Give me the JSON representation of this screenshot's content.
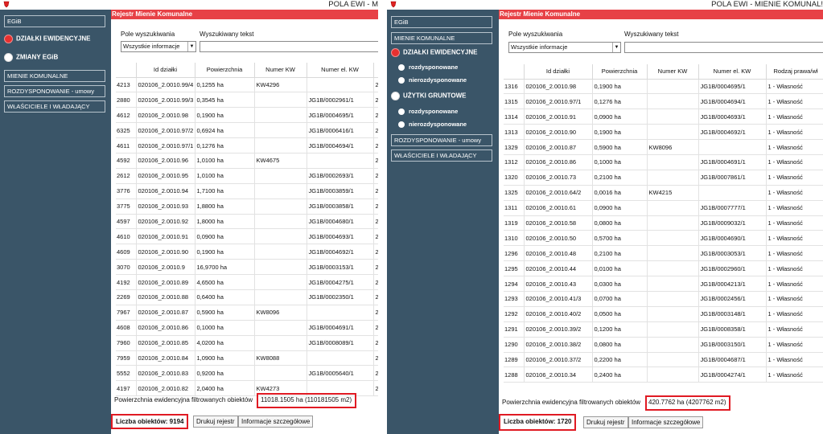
{
  "left": {
    "title": "POLA EWI - M",
    "sidebar": {
      "egib": "EGiB",
      "dzialki": "DZIAŁKI EWIDENCYJNE",
      "zmiany": "ZMIANY EGiB",
      "mienie": "MIENIE KOMUNALNE",
      "rozdysp": "ROZDYSPONOWANIE - umowy",
      "wlasciciele": "WŁAŚCICIELE I WŁADAJĄCY"
    },
    "header": "Rejestr Mienie Komunalne",
    "search": {
      "field_label": "Pole wyszukiwania",
      "field_value": "Wszystkie informacje",
      "text_label": "Wyszukiwany tekst",
      "text_value": ""
    },
    "columns": [
      "",
      "Id działki",
      "Powierzchnia",
      "Numer KW",
      "Numer el. KW",
      ""
    ],
    "rows": [
      [
        "4213",
        "020106_2.0010.99/4",
        "0,1255 ha",
        "KW4296",
        "",
        "2"
      ],
      [
        "2880",
        "020106_2.0010.99/3",
        "0,3545 ha",
        "",
        "JG1B/0002961/1",
        "2"
      ],
      [
        "4612",
        "020106_2.0010.98",
        "0,1900 ha",
        "",
        "JG1B/0004695/1",
        "2"
      ],
      [
        "6325",
        "020106_2.0010.97/2",
        "0,6924 ha",
        "",
        "JG1B/0006416/1",
        "2"
      ],
      [
        "4611",
        "020106_2.0010.97/1",
        "0,1276 ha",
        "",
        "JG1B/0004694/1",
        "2"
      ],
      [
        "4592",
        "020106_2.0010.96",
        "1,0100 ha",
        "KW4675",
        "",
        "2"
      ],
      [
        "2612",
        "020106_2.0010.95",
        "1,0100 ha",
        "",
        "JG1B/0002693/1",
        "2"
      ],
      [
        "3776",
        "020106_2.0010.94",
        "1,7100 ha",
        "",
        "JG1B/0003859/1",
        "2"
      ],
      [
        "3775",
        "020106_2.0010.93",
        "1,8800 ha",
        "",
        "JG1B/0003858/1",
        "2"
      ],
      [
        "4597",
        "020106_2.0010.92",
        "1,8000 ha",
        "",
        "JG1B/0004680/1",
        "2"
      ],
      [
        "4610",
        "020106_2.0010.91",
        "0,0900 ha",
        "",
        "JG1B/0004693/1",
        "2"
      ],
      [
        "4609",
        "020106_2.0010.90",
        "0,1900 ha",
        "",
        "JG1B/0004692/1",
        "2"
      ],
      [
        "3070",
        "020106_2.0010.9",
        "16,9700 ha",
        "",
        "JG1B/0003153/1",
        "2"
      ],
      [
        "4192",
        "020106_2.0010.89",
        "4,6500 ha",
        "",
        "JG1B/0004275/1",
        "2"
      ],
      [
        "2269",
        "020106_2.0010.88",
        "0,6400 ha",
        "",
        "JG1B/0002350/1",
        "2"
      ],
      [
        "7967",
        "020106_2.0010.87",
        "0,5900 ha",
        "KW8096",
        "",
        "2"
      ],
      [
        "4608",
        "020106_2.0010.86",
        "0,1000 ha",
        "",
        "JG1B/0004691/1",
        "2"
      ],
      [
        "7960",
        "020106_2.0010.85",
        "4,0200 ha",
        "",
        "JG1B/0008089/1",
        "2"
      ],
      [
        "7959",
        "020106_2.0010.84",
        "1,0900 ha",
        "KW8088",
        "",
        "2"
      ],
      [
        "5552",
        "020106_2.0010.83",
        "0,9200 ha",
        "",
        "JG1B/0005640/1",
        "2"
      ],
      [
        "4197",
        "020106_2.0010.82",
        "2,0400 ha",
        "KW4273",
        "",
        "2"
      ]
    ],
    "footer": {
      "area_label": "Powierzchnia ewidencyjna filtrowanych obiektów",
      "area_value": "11018.1505 ha (110181505 m2)",
      "count": "Liczba obiektów: 9194",
      "print": "Drukuj rejestr",
      "details": "Informacje szczegółowe"
    }
  },
  "right": {
    "title": "POLA EWI - MIENIE KOMUNAL!",
    "sidebar": {
      "egib": "EGiB",
      "mienie": "MIENIE KOMUNALNE",
      "dzialki": "DZIAŁKI EWIDENCYJNE",
      "rozdysp1": "rozdysponowane",
      "nierozdysp1": "nierozdysponowane",
      "uzytki": "UŻYTKI GRUNTOWE",
      "rozdysp2": "rozdysponowane",
      "nierozdysp2": "nierozdysponowane",
      "rozdysp_umowy": "ROZDYSPONOWANIE - umowy",
      "wlasciciele": "WŁAŚCICIELE I WŁADAJĄCY"
    },
    "header": "Rejestr Mienie Komunalne",
    "search": {
      "field_label": "Pole wyszukiwania",
      "field_value": "Wszystkie informacje",
      "text_label": "Wyszukiwany tekst",
      "text_value": ""
    },
    "columns": [
      "",
      "Id działki",
      "Powierzchnia",
      "Numer KW",
      "Numer el. KW",
      "Rodzaj prawa/wł"
    ],
    "rows": [
      [
        "1316",
        "020106_2.0010.98",
        "0,1900 ha",
        "",
        "JG1B/0004695/1",
        "1 - Własność"
      ],
      [
        "1315",
        "020106_2.0010.97/1",
        "0,1276 ha",
        "",
        "JG1B/0004694/1",
        "1 - Własność"
      ],
      [
        "1314",
        "020106_2.0010.91",
        "0,0900 ha",
        "",
        "JG1B/0004693/1",
        "1 - Własność"
      ],
      [
        "1313",
        "020106_2.0010.90",
        "0,1900 ha",
        "",
        "JG1B/0004692/1",
        "1 - Własność"
      ],
      [
        "1329",
        "020106_2.0010.87",
        "0,5900 ha",
        "KW8096",
        "",
        "1 - Własność"
      ],
      [
        "1312",
        "020106_2.0010.86",
        "0,1000 ha",
        "",
        "JG1B/0004691/1",
        "1 - Własność"
      ],
      [
        "1320",
        "020106_2.0010.73",
        "0,2100 ha",
        "",
        "JG1B/0007861/1",
        "1 - Własność"
      ],
      [
        "1325",
        "020106_2.0010.64/2",
        "0,0016 ha",
        "KW4215",
        "",
        "1 - Własność"
      ],
      [
        "1311",
        "020106_2.0010.61",
        "0,0900 ha",
        "",
        "JG1B/0007777/1",
        "1 - Własność"
      ],
      [
        "1319",
        "020106_2.0010.58",
        "0,0800 ha",
        "",
        "JG1B/0009032/1",
        "1 - Własność"
      ],
      [
        "1310",
        "020106_2.0010.50",
        "0,5700 ha",
        "",
        "JG1B/0004690/1",
        "1 - Własność"
      ],
      [
        "1296",
        "020106_2.0010.48",
        "0,2100 ha",
        "",
        "JG1B/0003053/1",
        "1 - Własność"
      ],
      [
        "1295",
        "020106_2.0010.44",
        "0,0100 ha",
        "",
        "JG1B/0002960/1",
        "1 - Własność"
      ],
      [
        "1294",
        "020106_2.0010.43",
        "0,0300 ha",
        "",
        "JG1B/0004213/1",
        "1 - Własność"
      ],
      [
        "1293",
        "020106_2.0010.41/3",
        "0,0700 ha",
        "",
        "JG1B/0002456/1",
        "1 - Własność"
      ],
      [
        "1292",
        "020106_2.0010.40/2",
        "0,0500 ha",
        "",
        "JG1B/0003148/1",
        "1 - Własność"
      ],
      [
        "1291",
        "020106_2.0010.39/2",
        "0,1200 ha",
        "",
        "JG1B/0008358/1",
        "1 - Własność"
      ],
      [
        "1290",
        "020106_2.0010.38/2",
        "0,0800 ha",
        "",
        "JG1B/0003150/1",
        "1 - Własność"
      ],
      [
        "1289",
        "020106_2.0010.37/2",
        "0,2200 ha",
        "",
        "JG1B/0004687/1",
        "1 - Własność"
      ],
      [
        "1288",
        "020106_2.0010.34",
        "0,2400 ha",
        "",
        "JG1B/0004274/1",
        "1 - Własność"
      ]
    ],
    "footer": {
      "area_label": "Powierzchnia ewidencyjna filtrowanych obiektów",
      "area_value": "420.7762 ha (4207762 m2)",
      "count": "Liczba obiektów: 1720",
      "print": "Drukuj rejestr",
      "details": "Informacje szczegółowe"
    }
  },
  "colors": {
    "sidebar": "#3a5568",
    "header_red": "#e74146",
    "highlight_outline": "#e01a23",
    "radio_selected": "#e8302f"
  },
  "icons": [
    "app-logo-icon",
    "radio-selected-icon",
    "radio-unselected-icon",
    "dropdown-arrow-icon"
  ]
}
